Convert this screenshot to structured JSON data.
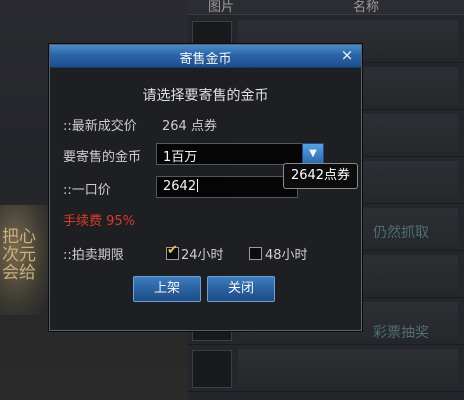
{
  "background": {
    "header_col1": "图片",
    "header_col2": "名称",
    "char_text_1": "把心",
    "char_text_2": "次元",
    "char_text_3": "会给",
    "faded_text_1": "仍然抓取",
    "faded_text_2": "彩票抽奖"
  },
  "dialog": {
    "title": "寄售金币",
    "close_label": "×",
    "prompt": "请选择要寄售的金币",
    "latest_price_label": "::最新成交价",
    "latest_price_value": "264 点券",
    "sell_gold_label": "要寄售的金币",
    "sell_gold_value": "1百万",
    "fixed_price_label": "::一口价",
    "fixed_price_value": "2642",
    "fixed_price_tooltip": "2642点券",
    "fee_label": "手续费",
    "fee_value": "95%",
    "duration_label": "::拍卖期限",
    "duration_options": [
      {
        "label": "24小时",
        "checked": true
      },
      {
        "label": "48小时",
        "checked": false
      }
    ],
    "list_button": "上架",
    "close_button": "关闭"
  },
  "colors": {
    "titlebar": "#2a67ad",
    "fee_red": "#e03c2c",
    "button_blue": "#285f9f"
  }
}
